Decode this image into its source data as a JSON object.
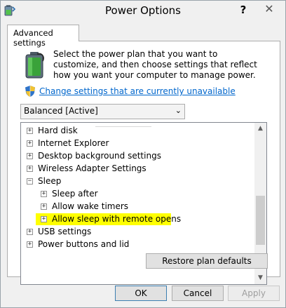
{
  "window": {
    "title": "Power Options",
    "help_glyph": "?",
    "close_glyph": "✕",
    "icon": "power-options-icon"
  },
  "tab": {
    "label": "Advanced settings"
  },
  "intro": {
    "description": "Select the power plan that you want to customize, and then choose settings that reflect how you want your computer to manage power.",
    "battery_icon": "battery-icon",
    "shield_icon": "uac-shield-icon",
    "change_link": "Change settings that are currently unavailable"
  },
  "plan_select": {
    "value": "Balanced [Active]",
    "chevron": "⌄"
  },
  "tree": {
    "items": [
      {
        "label": "Hard disk",
        "level": 0,
        "expander": "+"
      },
      {
        "label": "Internet Explorer",
        "level": 0,
        "expander": "+"
      },
      {
        "label": "Desktop background settings",
        "level": 0,
        "expander": "+"
      },
      {
        "label": "Wireless Adapter Settings",
        "level": 0,
        "expander": "+"
      },
      {
        "label": "Sleep",
        "level": 0,
        "expander": "−"
      },
      {
        "label": "Sleep after",
        "level": 1,
        "expander": "+"
      },
      {
        "label": "Allow wake timers",
        "level": 1,
        "expander": "+"
      },
      {
        "label": "Allow sleep with remote opens",
        "level": 1,
        "expander": "+",
        "highlighted": true
      },
      {
        "label": "USB settings",
        "level": 0,
        "expander": "+"
      },
      {
        "label": "Power buttons and lid",
        "level": 0,
        "expander": "+"
      }
    ],
    "scroll_up_glyph": "▲",
    "scroll_down_glyph": "▼",
    "highlight_color": "#ffff00"
  },
  "buttons": {
    "restore": "Restore plan defaults",
    "ok": "OK",
    "cancel": "Cancel",
    "apply": "Apply"
  },
  "colors": {
    "link": "#0066cc",
    "highlight": "#ffff00",
    "disabled_text": "#9e9e9e"
  }
}
